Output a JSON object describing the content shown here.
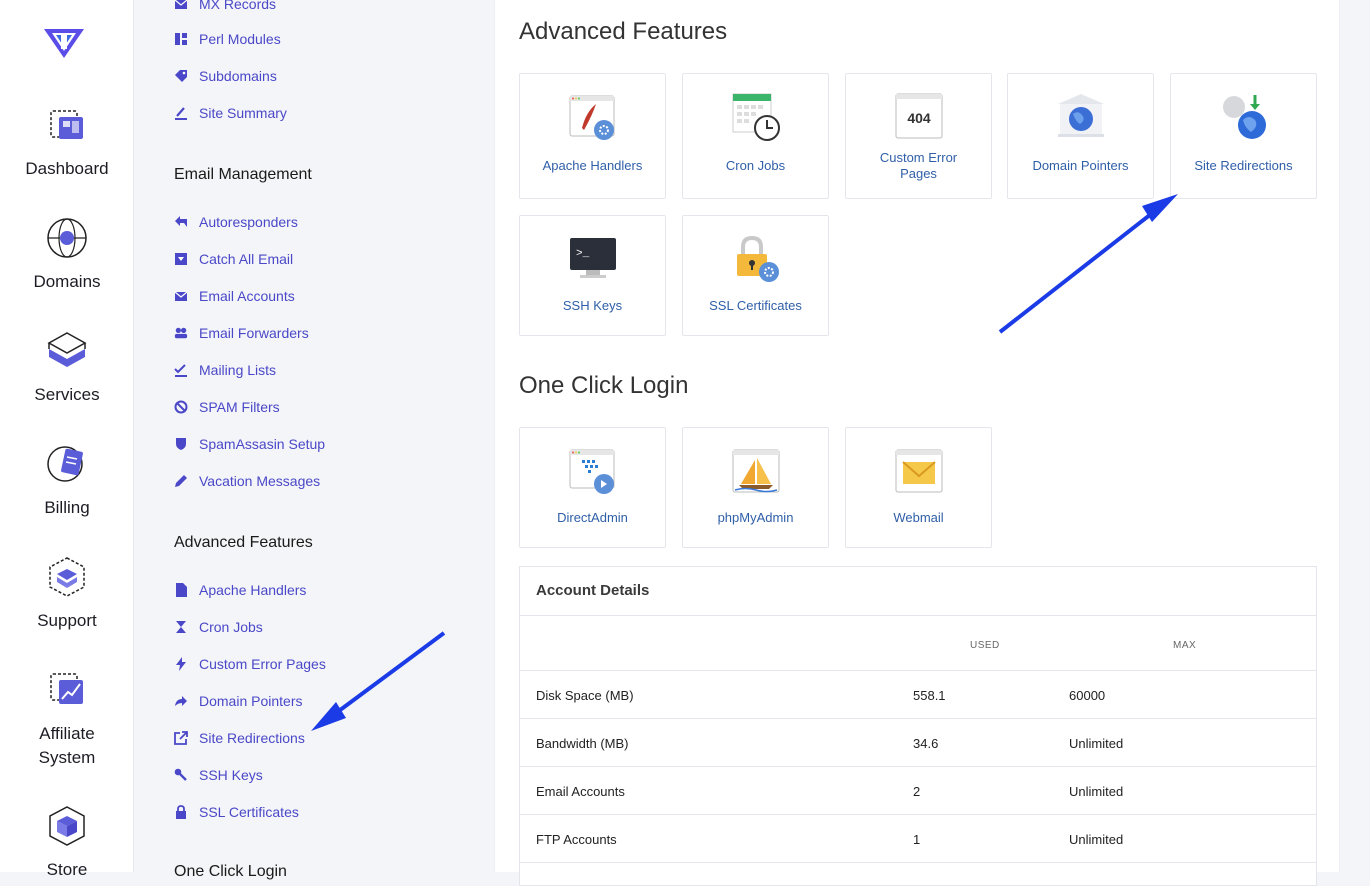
{
  "rail": {
    "items": [
      {
        "label": "Dashboard"
      },
      {
        "label": "Domains"
      },
      {
        "label": "Services"
      },
      {
        "label": "Billing"
      },
      {
        "label": "Support"
      },
      {
        "label_line1": "Affiliate",
        "label_line2": "System"
      },
      {
        "label": "Store"
      }
    ]
  },
  "menu": {
    "top_items": [
      {
        "label": "MX Records",
        "icon": "mail-icon"
      },
      {
        "label": "Perl Modules",
        "icon": "grid-icon"
      },
      {
        "label": "Subdomains",
        "icon": "tag-icon"
      },
      {
        "label": "Site Summary",
        "icon": "chart-icon"
      }
    ],
    "email_heading": "Email Management",
    "email_items": [
      {
        "label": "Autoresponders",
        "icon": "reply-icon"
      },
      {
        "label": "Catch All Email",
        "icon": "inbox-icon"
      },
      {
        "label": "Email Accounts",
        "icon": "envelope-icon"
      },
      {
        "label": "Email Forwarders",
        "icon": "users-icon"
      },
      {
        "label": "Mailing Lists",
        "icon": "list-check-icon"
      },
      {
        "label": "SPAM Filters",
        "icon": "ban-icon"
      },
      {
        "label": "SpamAssasin Setup",
        "icon": "shield-icon"
      },
      {
        "label": "Vacation Messages",
        "icon": "pencil-icon"
      }
    ],
    "advanced_heading": "Advanced Features",
    "advanced_items": [
      {
        "label": "Apache Handlers",
        "icon": "file-icon"
      },
      {
        "label": "Cron Jobs",
        "icon": "hourglass-icon"
      },
      {
        "label": "Custom Error Pages",
        "icon": "bolt-icon"
      },
      {
        "label": "Domain Pointers",
        "icon": "share-arrow-icon"
      },
      {
        "label": "Site Redirections",
        "icon": "external-link-icon"
      },
      {
        "label": "SSH Keys",
        "icon": "key-icon"
      },
      {
        "label": "SSL Certificates",
        "icon": "lock-icon"
      }
    ],
    "oneclick_heading": "One Click Login"
  },
  "main": {
    "advanced_title": "Advanced Features",
    "advanced_cards": [
      {
        "label": "Apache Handlers"
      },
      {
        "label": "Cron Jobs"
      },
      {
        "label_line1": "Custom Error",
        "label_line2": "Pages",
        "badge": "404"
      },
      {
        "label": "Domain Pointers"
      },
      {
        "label": "Site Redirections"
      },
      {
        "label": "SSH Keys",
        "prompt": ">_"
      },
      {
        "label": "SSL Certificates"
      }
    ],
    "oneclick_title": "One Click Login",
    "oneclick_cards": [
      {
        "label": "DirectAdmin"
      },
      {
        "label": "phpMyAdmin"
      },
      {
        "label": "Webmail"
      }
    ],
    "account": {
      "title": "Account Details",
      "col_used": "USED",
      "col_max": "MAX",
      "rows": [
        {
          "name": "Disk Space (MB)",
          "used": "558.1",
          "max": "60000"
        },
        {
          "name": "Bandwidth (MB)",
          "used": "34.6",
          "max": "Unlimited"
        },
        {
          "name": "Email Accounts",
          "used": "2",
          "max": "Unlimited"
        },
        {
          "name": "FTP Accounts",
          "used": "1",
          "max": "Unlimited"
        }
      ]
    }
  },
  "colors": {
    "accent": "#4a48c8",
    "card_link": "#2f5fa8",
    "arrow": "#1a3be6"
  }
}
